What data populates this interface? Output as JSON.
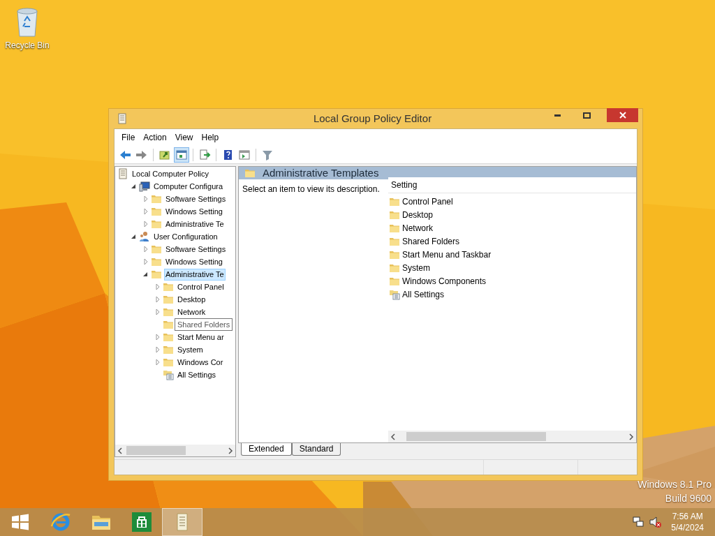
{
  "desktop": {
    "icons": [
      {
        "label": "Recycle Bin"
      }
    ],
    "watermark": [
      "Windows 8.1 Pro",
      "Build 9600"
    ]
  },
  "window": {
    "title": "Local Group Policy Editor",
    "menu": [
      "File",
      "Action",
      "View",
      "Help"
    ],
    "toolbar": [
      {
        "kind": "back",
        "pressed": false
      },
      {
        "kind": "forward",
        "pressed": false
      },
      {
        "kind": "sep"
      },
      {
        "kind": "up",
        "pressed": false
      },
      {
        "kind": "showhide",
        "pressed": true
      },
      {
        "kind": "sep"
      },
      {
        "kind": "export",
        "pressed": false
      },
      {
        "kind": "sep"
      },
      {
        "kind": "help",
        "pressed": false
      },
      {
        "kind": "pane",
        "pressed": false
      },
      {
        "kind": "sep"
      },
      {
        "kind": "filter",
        "pressed": false
      }
    ],
    "tree": [
      {
        "label": "Local Computer Policy",
        "kind": "policy",
        "children": [
          {
            "label": "Computer Configura",
            "kind": "computer",
            "expanded": true,
            "selected": false,
            "children": [
              {
                "label": "Software Settings",
                "kind": "folder",
                "expanded": false,
                "selected": false
              },
              {
                "label": "Windows Setting",
                "kind": "folder",
                "expanded": false,
                "selected": false
              },
              {
                "label": "Administrative Te",
                "kind": "folder",
                "expanded": false,
                "selected": false
              }
            ]
          },
          {
            "label": "User Configuration",
            "kind": "user",
            "expanded": true,
            "selected": false,
            "children": [
              {
                "label": "Software Settings",
                "kind": "folder",
                "expanded": false,
                "selected": false
              },
              {
                "label": "Windows Setting",
                "kind": "folder",
                "expanded": false,
                "selected": false
              },
              {
                "label": "Administrative Te",
                "kind": "folder",
                "expanded": true,
                "selected": true,
                "children": [
                  {
                    "label": "Control Panel",
                    "kind": "folder",
                    "expanded": false,
                    "selected": false
                  },
                  {
                    "label": "Desktop",
                    "kind": "folder",
                    "expanded": false,
                    "selected": false
                  },
                  {
                    "label": "Network",
                    "kind": "folder",
                    "expanded": false,
                    "selected": false
                  },
                  {
                    "label": "Shared Folders",
                    "kind": "folder",
                    "tooltip": true,
                    "selected": false
                  },
                  {
                    "label": "Start Menu ar",
                    "kind": "folder",
                    "expanded": false,
                    "selected": false
                  },
                  {
                    "label": "System",
                    "kind": "folder",
                    "expanded": false,
                    "selected": false
                  },
                  {
                    "label": "Windows Cor",
                    "kind": "folder",
                    "expanded": false,
                    "selected": false
                  },
                  {
                    "label": "All Settings",
                    "kind": "settings",
                    "selected": false
                  }
                ]
              }
            ]
          }
        ]
      }
    ],
    "details": {
      "header": "Administrative Templates",
      "description": "Select an item to view its description.",
      "column": "Setting",
      "items": [
        {
          "label": "Control Panel",
          "kind": "folder"
        },
        {
          "label": "Desktop",
          "kind": "folder"
        },
        {
          "label": "Network",
          "kind": "folder"
        },
        {
          "label": "Shared Folders",
          "kind": "folder"
        },
        {
          "label": "Start Menu and Taskbar",
          "kind": "folder"
        },
        {
          "label": "System",
          "kind": "folder"
        },
        {
          "label": "Windows Components",
          "kind": "folder"
        },
        {
          "label": "All Settings",
          "kind": "settings"
        }
      ]
    },
    "tabs": [
      {
        "label": "Extended",
        "selected": true
      },
      {
        "label": "Standard",
        "selected": false
      }
    ]
  },
  "taskbar": {
    "apps": [
      {
        "kind": "start",
        "active": false
      },
      {
        "kind": "ie",
        "active": false
      },
      {
        "kind": "explorer",
        "active": false
      },
      {
        "kind": "store",
        "active": false
      },
      {
        "kind": "gpedit",
        "active": true
      }
    ],
    "time": "7:56 AM",
    "date": "5/4/2024"
  }
}
